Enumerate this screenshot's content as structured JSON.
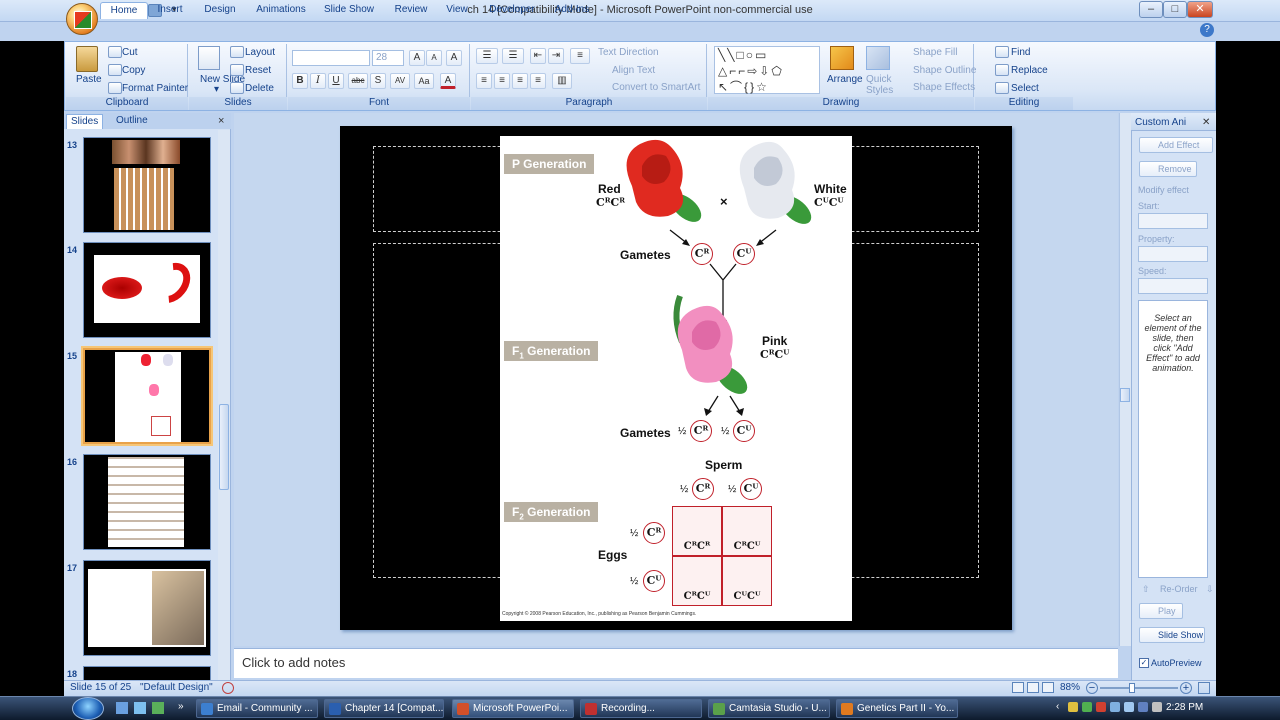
{
  "window": {
    "title": "ch 14 [Compatibility Mode] - Microsoft PowerPoint non-commercial use",
    "controls": {
      "minimize": "–",
      "maximize": "□",
      "close": "✕"
    }
  },
  "ribbon": {
    "tabs": [
      "Home",
      "Insert",
      "Design",
      "Animations",
      "Slide Show",
      "Review",
      "View",
      "Developer",
      "Add-Ins"
    ],
    "active_tab": "Home",
    "help": "?",
    "clipboard": {
      "label": "Clipboard",
      "paste": "Paste",
      "cut": "Cut",
      "copy": "Copy",
      "format_painter": "Format Painter"
    },
    "slides": {
      "label": "Slides",
      "new_slide": "New Slide",
      "new_slide_arrow": "▾",
      "layout": "Layout",
      "reset": "Reset",
      "delete": "Delete"
    },
    "font": {
      "label": "Font",
      "font_name": "",
      "font_size": "28",
      "grow": "A",
      "shrink": "A",
      "clear": "A",
      "bold": "B",
      "italic": "I",
      "underline": "U",
      "strike": "abc",
      "shadow": "S",
      "spacing": "AV",
      "case": "Aa",
      "color": "A"
    },
    "paragraph": {
      "label": "Paragraph",
      "text_direction": "Text Direction",
      "align_text": "Align Text",
      "smartart": "Convert to SmartArt"
    },
    "drawing": {
      "label": "Drawing",
      "arrange": "Arrange",
      "quick_styles": "Quick Styles",
      "shape_fill": "Shape Fill",
      "shape_outline": "Shape Outline",
      "shape_effects": "Shape Effects"
    },
    "editing": {
      "label": "Editing",
      "find": "Find",
      "replace": "Replace",
      "select": "Select"
    }
  },
  "slides_pane": {
    "tabs": [
      "Slides",
      "Outline"
    ],
    "active_tab": "Slides",
    "close": "×",
    "thumbnails": [
      {
        "number": "13"
      },
      {
        "number": "14"
      },
      {
        "number": "15",
        "selected": true
      },
      {
        "number": "16"
      },
      {
        "number": "17"
      },
      {
        "number": "18"
      }
    ]
  },
  "slide": {
    "figure": {
      "p_generation": "P Generation",
      "f1_prefix": "F",
      "f1_sub": "1",
      "f1_suffix": " Generation",
      "f2_prefix": "F",
      "f2_sub": "2",
      "f2_suffix": " Generation",
      "red": "Red",
      "white": "White",
      "pink": "Pink",
      "genotype_rr": "CᴿCᴿ",
      "genotype_ww": "CᵂCᵂ",
      "genotype_rw": "CᴿCᵂ",
      "cross": "×",
      "gametes_1": "Gametes",
      "gametes_2": "Gametes",
      "allele_r": "Cᴿ",
      "allele_w": "Cᵂ",
      "half": "½",
      "sperm": "Sperm",
      "eggs": "Eggs",
      "cell_rr": "CᴿCᴿ",
      "cell_rw_1": "CᴿCᵂ",
      "cell_rw_2": "CᴿCᵂ",
      "cell_ww": "CᵂCᵂ",
      "copyright": "Copyright © 2008 Pearson Education, Inc., publishing as Pearson Benjamin Cummings."
    }
  },
  "notes": {
    "placeholder": "Click to add notes"
  },
  "custom_animation": {
    "title": "Custom Ani",
    "close": "✕",
    "add_effect": "Add Effect",
    "remove": "Remove",
    "modify_effect": "Modify effect",
    "start": "Start:",
    "property": "Property:",
    "speed": "Speed:",
    "hint": "Select an element of the slide, then click \"Add Effect\" to add animation.",
    "reorder": "Re-Order",
    "play": "Play",
    "slide_show": "Slide Show",
    "autopreview": "AutoPreview"
  },
  "status_bar": {
    "slide_info": "Slide 15 of 25",
    "theme": "\"Default Design\"",
    "zoom": "88%"
  },
  "taskbar": {
    "items": [
      {
        "label": "Email - Community ...",
        "color": "#3c7fd0"
      },
      {
        "label": "Chapter 14 [Compat...",
        "color": "#2a5fb0"
      },
      {
        "label": "Microsoft PowerPoi...",
        "color": "#d2502a",
        "active": true
      },
      {
        "label": "Recording...",
        "color": "#c03030"
      },
      {
        "label": "Camtasia Studio - U...",
        "color": "#5aa04a"
      },
      {
        "label": "Genetics Part II - Yo...",
        "color": "#e07a20"
      }
    ],
    "clock": "2:28 PM"
  },
  "colors": {
    "accent": "#15428b",
    "allele_ring": "#c0202a",
    "generation_label": "#b9b1a3",
    "selected_thumb": "#e8a24a"
  }
}
